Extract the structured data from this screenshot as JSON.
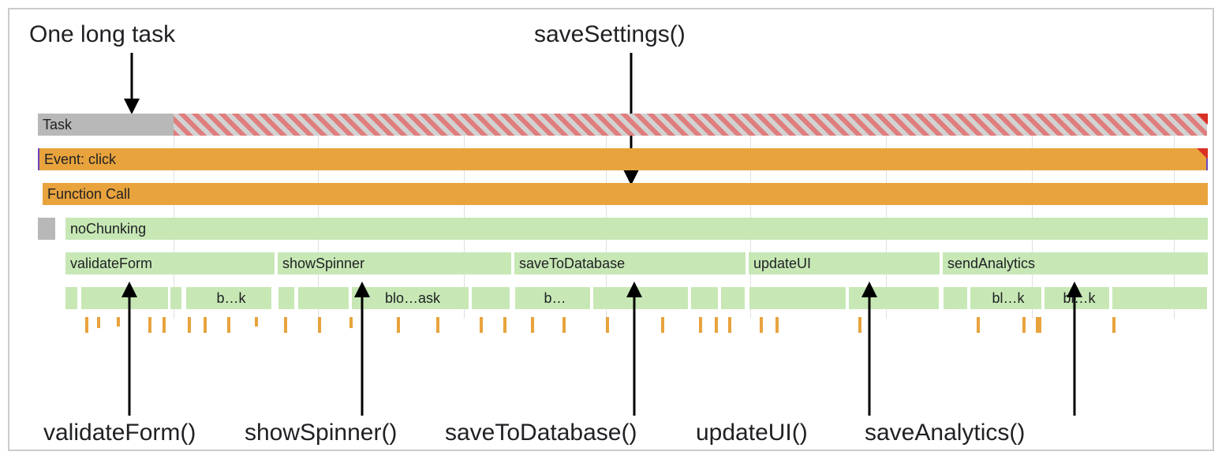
{
  "annotations": {
    "top_left": "One long task",
    "top_right": "saveSettings()",
    "bottom": {
      "validateForm": "validateForm()",
      "showSpinner": "showSpinner()",
      "saveToDatabase": "saveToDatabase()",
      "updateUI": "updateUI()",
      "saveAnalytics": "saveAnalytics()"
    }
  },
  "tracks": {
    "task": "Task",
    "event": "Event: click",
    "function_call": "Function Call",
    "no_chunking": "noChunking",
    "children": {
      "validateForm": "validateForm",
      "showSpinner": "showSpinner",
      "saveToDatabase": "saveToDatabase",
      "updateUI": "updateUI",
      "sendAnalytics": "sendAnalytics"
    },
    "truncated": {
      "bk1": "b…k",
      "blo_ask": "blo…ask",
      "b": "b…",
      "blk1": "bl…k",
      "blk2": "bl…k"
    }
  }
}
